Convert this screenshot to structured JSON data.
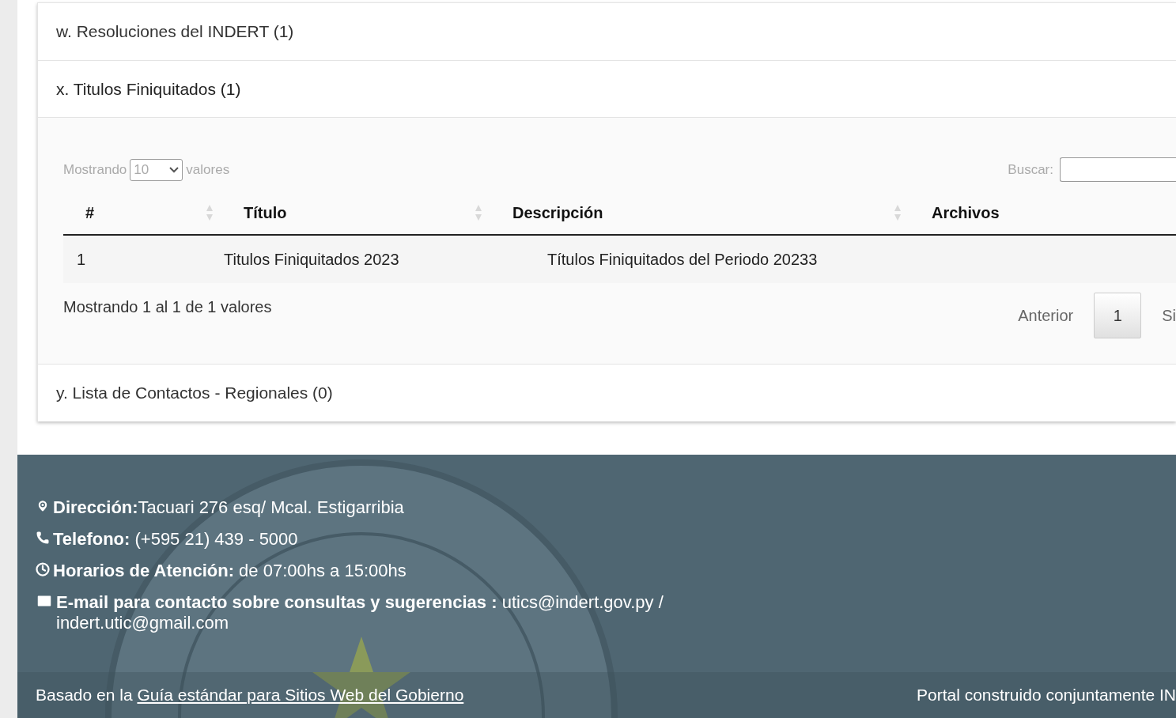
{
  "accordion": [
    {
      "title": "w. Resoluciones del INDERT (1)",
      "expanded": false
    },
    {
      "title": "x. Titulos Finiquitados (1)",
      "expanded": true,
      "table": {
        "length_label_before": "Mostrando",
        "length_value": "10",
        "length_label_after": "valores",
        "search_label": "Buscar:",
        "columns": [
          "#",
          "Título",
          "Descripción",
          "Archivos"
        ],
        "rows": [
          [
            "1",
            "Titulos Finiquitados 2023",
            "Títulos Finiquitados del Periodo 20233",
            ""
          ]
        ],
        "info": "Mostrando 1 al 1 de 1 valores",
        "pagination": {
          "previous": "Anterior",
          "pages": [
            {
              "label": "1",
              "selected": true
            }
          ],
          "next": "Si"
        }
      }
    },
    {
      "title": "y. Lista de Contactos - Regionales (0)",
      "expanded": false
    }
  ],
  "footer": {
    "contacts": [
      {
        "kind": "address",
        "label": "Dirección:",
        "value": "Tacuari 276 esq/ Mcal. Estigarribia"
      },
      {
        "kind": "phone",
        "label": "Telefono:",
        "value": " (+595 21) 439 - 5000"
      },
      {
        "kind": "hours",
        "label": "Horarios de Atención:",
        "value": " de 07:00hs a 15:00hs"
      },
      {
        "kind": "email",
        "label": "E-mail para contacto sobre consultas y sugerencias :",
        "value": " utics@indert.gov.py / indert.utic@gmail.com"
      }
    ],
    "bottom": {
      "prefix": "Basado en la",
      "link": "Guía estándar para Sitios Web del Gobierno",
      "right": "Portal construido conjuntamente IN"
    }
  }
}
